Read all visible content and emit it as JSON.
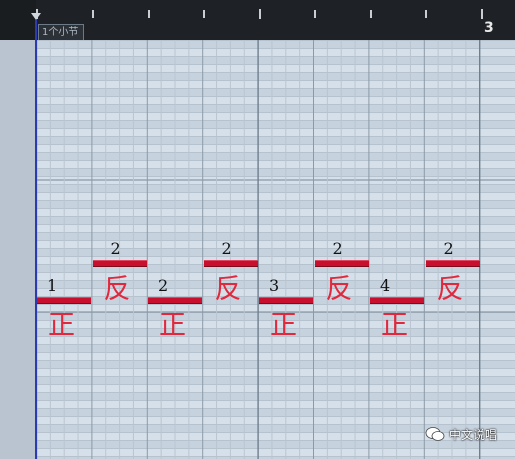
{
  "ruler": {
    "section_tag": "1个小节",
    "bar_end_label": "3"
  },
  "colors": {
    "note": "#c8102e",
    "annotation": "#e2283c",
    "grid_bg": "#cdd8e4",
    "playhead": "#2c3bb0"
  },
  "notes": [
    {
      "velocity_label": "1",
      "annotation": "正",
      "pitch": "low"
    },
    {
      "velocity_label": "2",
      "annotation": "反",
      "pitch": "high"
    },
    {
      "velocity_label": "2",
      "annotation": "正",
      "pitch": "low"
    },
    {
      "velocity_label": "2",
      "annotation": "反",
      "pitch": "high"
    },
    {
      "velocity_label": "3",
      "annotation": "正",
      "pitch": "low"
    },
    {
      "velocity_label": "2",
      "annotation": "反",
      "pitch": "high"
    },
    {
      "velocity_label": "4",
      "annotation": "正",
      "pitch": "low"
    },
    {
      "velocity_label": "2",
      "annotation": "反",
      "pitch": "high"
    }
  ],
  "watermark": {
    "icon": "wechat-icon",
    "text": "中文说唱"
  }
}
